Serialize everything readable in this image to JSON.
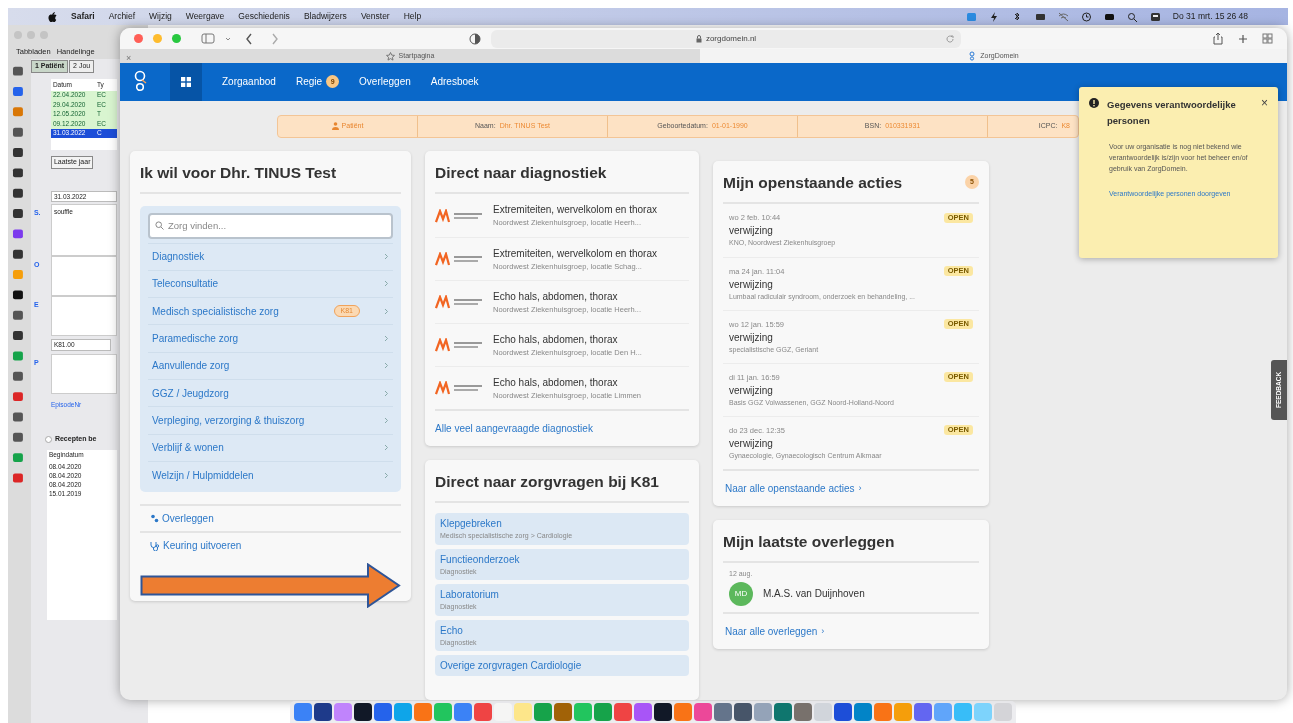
{
  "menu_bar": {
    "app": "Safari",
    "menus": [
      "Archief",
      "Wijzig",
      "Weergave",
      "Geschiedenis",
      "Bladwijzers",
      "Venster",
      "Help"
    ],
    "clock": "Do 31 mrt. 15 26 48"
  },
  "background_app": {
    "toolbar": [
      "Tabbladen",
      "Handelinge"
    ],
    "tabs": [
      {
        "label": "1 Patiënt",
        "selected": true
      },
      {
        "label": "2 Jou",
        "selected": false
      }
    ],
    "journal": {
      "columns": [
        "Datum",
        "Ty"
      ],
      "rows": [
        {
          "date": "22.04.2020",
          "type": "EC",
          "selected": false
        },
        {
          "date": "29.04.2020",
          "type": "EC",
          "selected": false
        },
        {
          "date": "12.05.2020",
          "type": "T",
          "selected": false
        },
        {
          "date": "09.12.2020",
          "type": "EC",
          "selected": false
        },
        {
          "date": "31.03.2022",
          "type": "C",
          "selected": true
        }
      ]
    },
    "period_button": "Laatste jaar",
    "date_field": "31.03.2022",
    "soep": [
      {
        "letter": "S.",
        "text": "souffle"
      },
      {
        "letter": "O"
      },
      {
        "letter": "E"
      },
      {
        "letter": "P"
      }
    ],
    "code_field": "K81.00",
    "episode_link": "EpisodeNr",
    "recipes_checkbox": {
      "label": "Recepten be",
      "checked": false
    },
    "recipes_table": {
      "column": "Begindatum",
      "rows": [
        "08.04.2020",
        "08.04.2020",
        "08.04.2020",
        "15.01.2019"
      ]
    }
  },
  "browser": {
    "address": "zorgdomein.nl",
    "tabs": [
      {
        "label": "Startpagina",
        "selected": false
      },
      {
        "label": "ZorgDomein",
        "selected": true
      }
    ],
    "close_tab": "×"
  },
  "nav": {
    "home_selected": true,
    "items": [
      {
        "label": "Zorgaanbod"
      },
      {
        "label": "Regie",
        "badge": "9"
      },
      {
        "label": "Overleggen"
      },
      {
        "label": "Adresboek"
      }
    ]
  },
  "patient_bar": {
    "title": "Patiënt",
    "fields": [
      {
        "label": "Naam:",
        "value": "Dhr. TINUS Test"
      },
      {
        "label": "Geboortedatum:",
        "value": "01-01-1990"
      },
      {
        "label": "BSN:",
        "value": "010331931"
      },
      {
        "label": "ICPC:",
        "value": "K8"
      }
    ]
  },
  "care_card": {
    "title": "Ik wil voor Dhr. TINUS Test",
    "search_placeholder": "Zorg vinden...",
    "categories": [
      {
        "label": "Diagnostiek"
      },
      {
        "label": "Teleconsultatie"
      },
      {
        "label": "Medisch specialistische zorg",
        "badge": "K81"
      },
      {
        "label": "Paramedische zorg"
      },
      {
        "label": "Aanvullende zorg"
      },
      {
        "label": "GGZ / Jeugdzorg"
      },
      {
        "label": "Verpleging, verzorging & thuiszorg"
      },
      {
        "label": "Verblijf & wonen"
      },
      {
        "label": "Welzijn / Hulpmiddelen"
      }
    ],
    "links": [
      {
        "label": "Overleggen",
        "kind": "people"
      },
      {
        "label": "Keuring uitvoeren",
        "kind": "stethoscope"
      }
    ]
  },
  "diagnostics_card": {
    "title": "Direct naar diagnostiek",
    "items": [
      {
        "title": "Extremiteiten, wervelkolom en thorax",
        "location": "Noordwest Ziekenhuisgroep, locatie Heerh..."
      },
      {
        "title": "Extremiteiten, wervelkolom en thorax",
        "location": "Noordwest Ziekenhuisgroep, locatie Schag..."
      },
      {
        "title": "Echo hals, abdomen, thorax",
        "location": "Noordwest Ziekenhuisgroep, locatie Heerh..."
      },
      {
        "title": "Echo hals, abdomen, thorax",
        "location": "Noordwest Ziekenhuisgroep, locatie Den H..."
      },
      {
        "title": "Echo hals, abdomen, thorax",
        "location": "Noordwest Ziekenhuisgroep, locatie Limmen"
      }
    ],
    "link": "Alle veel aangevraagde diagnostiek"
  },
  "questions_card": {
    "title": "Direct naar zorgvragen bij K81",
    "items": [
      {
        "title": "Klepgebreken",
        "subtitle": "Medisch specialistische zorg > Cardiologie"
      },
      {
        "title": "Functieonderzoek",
        "subtitle": "Diagnostiek"
      },
      {
        "title": "Laboratorium",
        "subtitle": "Diagnostiek"
      },
      {
        "title": "Echo",
        "subtitle": "Diagnostiek"
      },
      {
        "title": "Overige zorgvragen Cardiologie"
      }
    ]
  },
  "actions_card": {
    "title": "Mijn openstaande acties",
    "count": "5",
    "items": [
      {
        "date": "wo 2 feb. 10:44",
        "status": "OPEN",
        "title": "verwijzing",
        "detail": "KNO, Noordwest Ziekenhuisgroep"
      },
      {
        "date": "ma 24 jan. 11:04",
        "status": "OPEN",
        "title": "verwijzing",
        "detail": "Lumbaal radiculair syndroom, onderzoek en behandeling, ..."
      },
      {
        "date": "wo 12 jan. 15:59",
        "status": "OPEN",
        "title": "verwijzing",
        "detail": "specialistische GGZ, Geriant"
      },
      {
        "date": "di 11 jan. 16:59",
        "status": "OPEN",
        "title": "verwijzing",
        "detail": "Basis GGZ Volwassenen, GGZ Noord-Holland-Noord"
      },
      {
        "date": "do 23 dec. 12:35",
        "status": "OPEN",
        "title": "verwijzing",
        "detail": "Gynaecologie, Gynaecologisch Centrum Alkmaar"
      }
    ],
    "link": "Naar alle openstaande acties",
    "link_chevron": "›"
  },
  "consults_card": {
    "title": "Mijn laatste overleggen",
    "items": [
      {
        "date": "12 aug.",
        "initials": "MD",
        "color": "#5cb85c",
        "name": "M.A.S. van Duijnhoven"
      }
    ],
    "link": "Naar alle overleggen",
    "link_chevron": "›"
  },
  "notification": {
    "title": "Gegevens verantwoordelijke personen",
    "close": "×",
    "body": "Voor uw organisatie is nog niet bekend wie verantwoordelijk is/zijn voor het beheer en/of gebruik van ZorgDomein.",
    "link": "Verantwoordelijke personen doorgeven"
  },
  "feedback_tab": "FEEDBACK",
  "dock": [
    {
      "color": "#3b82f6"
    },
    {
      "color": "#1e3a8a"
    },
    {
      "color": "#c084fc"
    },
    {
      "color": "#111827"
    },
    {
      "color": "#2563eb"
    },
    {
      "color": "#0ea5e9"
    },
    {
      "color": "#f97316"
    },
    {
      "color": "#22c55e"
    },
    {
      "color": "#3b82f6"
    },
    {
      "color": "#ef4444"
    },
    {
      "color": "#f5f5f4"
    },
    {
      "color": "#fde68a"
    },
    {
      "color": "#16a34a"
    },
    {
      "color": "#a16207"
    },
    {
      "color": "#22c55e"
    },
    {
      "color": "#16a34a"
    },
    {
      "color": "#ef4444"
    },
    {
      "color": "#a855f7"
    },
    {
      "color": "#111827"
    },
    {
      "color": "#f97316"
    },
    {
      "color": "#ec4899"
    },
    {
      "color": "#64748b"
    },
    {
      "color": "#475569"
    },
    {
      "color": "#94a3b8"
    },
    {
      "color": "#0f766e"
    },
    {
      "color": "#78716c"
    },
    {
      "color": "#d1d5db"
    },
    {
      "color": "#1d4ed8"
    },
    {
      "color": "#0284c7"
    },
    {
      "color": "#f97316"
    },
    {
      "color": "#f59e0b"
    },
    {
      "color": "#6366f1"
    },
    {
      "color": "#60a5fa"
    },
    {
      "color": "#38bdf8"
    },
    {
      "color": "#7dd3fc"
    },
    {
      "color": "#d4d4d8"
    }
  ]
}
